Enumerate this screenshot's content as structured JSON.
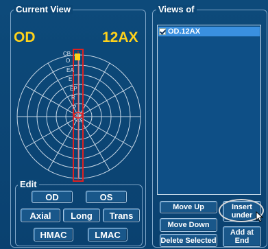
{
  "current_view": {
    "title": "Current View",
    "eye": "OD",
    "scan": "12AX"
  },
  "fundus_labels": [
    "CB",
    "O",
    "EA",
    "E",
    "EP",
    "R",
    "P"
  ],
  "edit": {
    "title": "Edit",
    "buttons": {
      "od": "OD",
      "os": "OS",
      "axial": "Axial",
      "long": "Long",
      "trans": "Trans",
      "hmac": "HMAC",
      "lmac": "LMAC"
    }
  },
  "views_of": {
    "title": "Views of",
    "items": [
      {
        "label": "OD.12AX",
        "checked": true,
        "selected": true
      }
    ],
    "buttons": {
      "move_up": "Move Up",
      "move_down": "Move Down",
      "delete_selected": "Delete Selected",
      "insert_under_line1": "Insert",
      "insert_under_line2": "under",
      "add_at_end_line1": "Add at",
      "add_at_end_line2": "End"
    }
  },
  "colors": {
    "background": "#0b4472",
    "accent_yellow": "#ffd21a",
    "probe_red": "#e02020",
    "selection_blue": "#3a90e0"
  }
}
